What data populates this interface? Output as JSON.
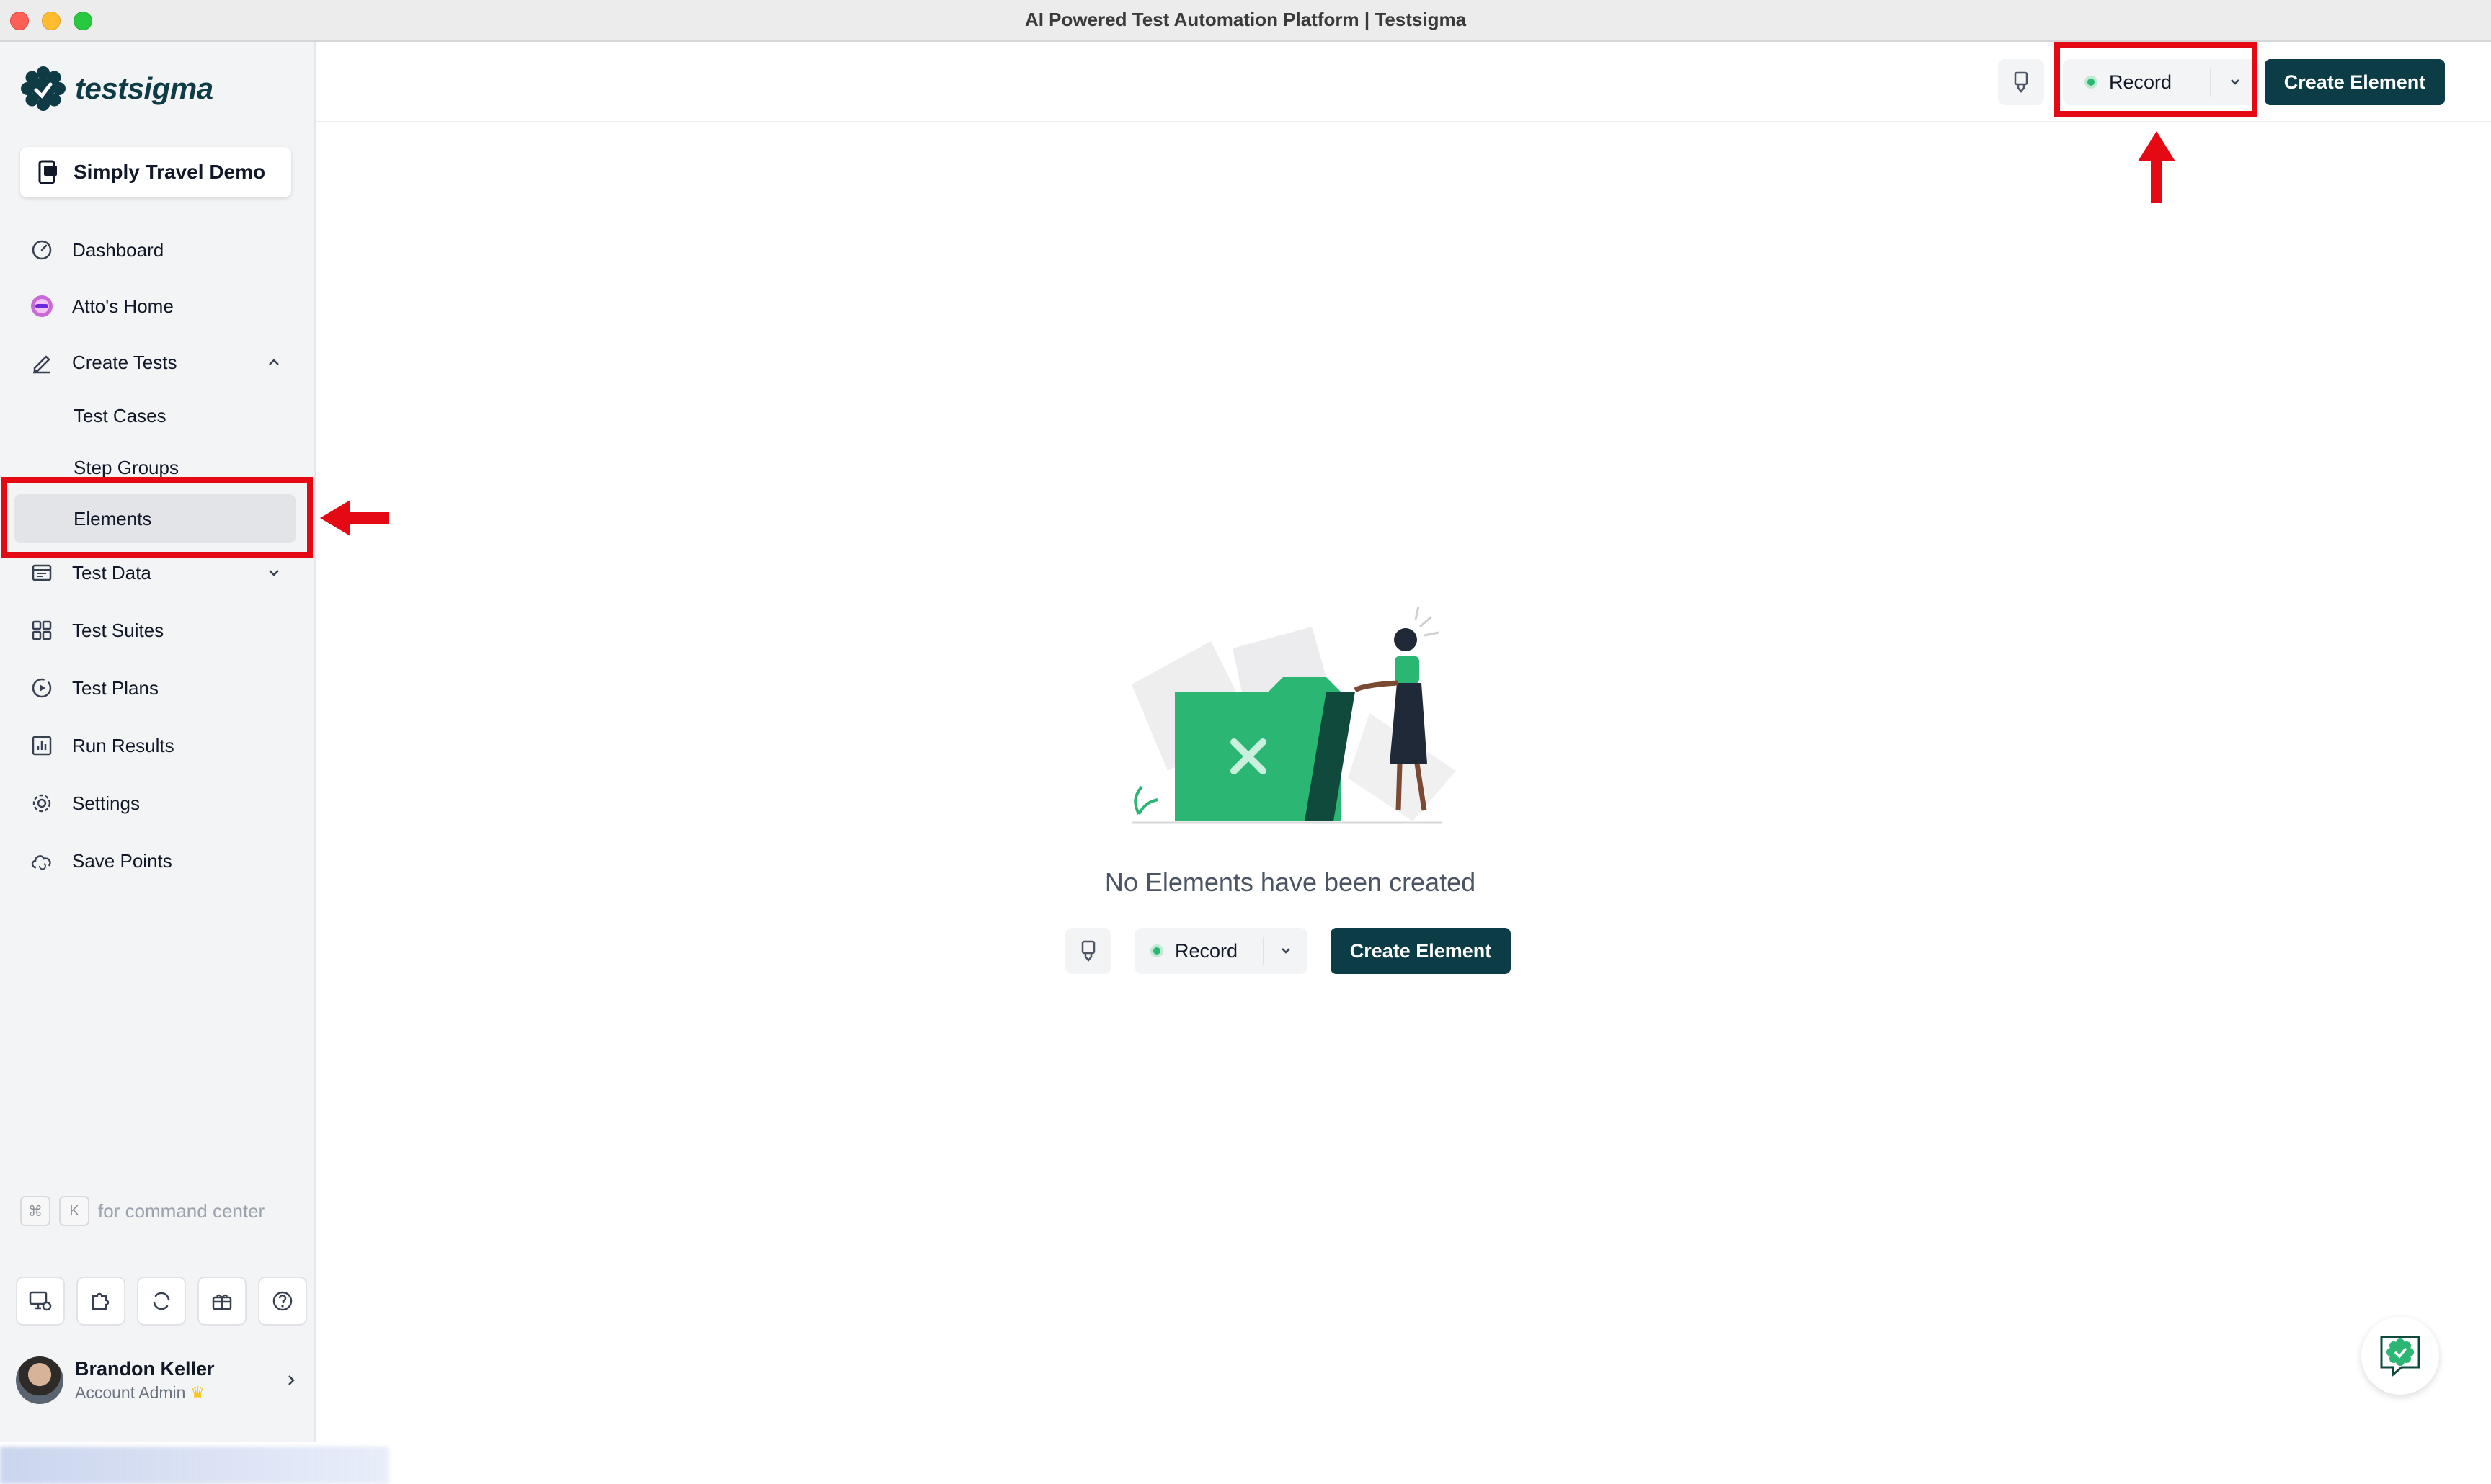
{
  "window": {
    "title": "AI Powered Test Automation Platform | Testsigma"
  },
  "brand": {
    "name": "testsigma",
    "color": "#0f3b46"
  },
  "project": {
    "name": "Simply Travel Demo"
  },
  "nav": {
    "dashboard": "Dashboard",
    "attos_home": "Atto's Home",
    "create_tests": "Create Tests",
    "sub": {
      "test_cases": "Test Cases",
      "step_groups": "Step Groups",
      "elements": "Elements"
    },
    "test_data": "Test Data",
    "test_suites": "Test Suites",
    "test_plans": "Test Plans",
    "run_results": "Run Results",
    "settings": "Settings",
    "save_points": "Save Points"
  },
  "command_center": {
    "key1": "⌘",
    "key2": "K",
    "label": "for command center"
  },
  "user": {
    "name": "Brandon Keller",
    "role": "Account Admin"
  },
  "header": {
    "record_label": "Record",
    "create_label": "Create Element"
  },
  "empty_state": {
    "message": "No Elements have been created",
    "record_label": "Record",
    "create_label": "Create Element"
  },
  "colors": {
    "primary": "#0c3c46",
    "accent_green": "#2bb673",
    "annotation_red": "#e50914"
  }
}
